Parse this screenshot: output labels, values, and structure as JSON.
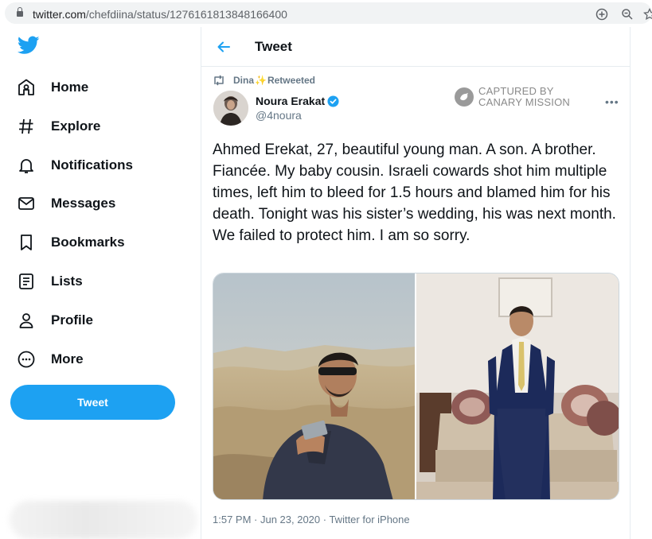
{
  "browser": {
    "url_host": "twitter.com",
    "url_path": "/chefdiina/status/1276161813848166400"
  },
  "sidebar": {
    "items": [
      {
        "label": "Home",
        "icon": "home-icon"
      },
      {
        "label": "Explore",
        "icon": "hashtag-icon"
      },
      {
        "label": "Notifications",
        "icon": "bell-icon"
      },
      {
        "label": "Messages",
        "icon": "envelope-icon"
      },
      {
        "label": "Bookmarks",
        "icon": "bookmark-icon"
      },
      {
        "label": "Lists",
        "icon": "list-icon"
      },
      {
        "label": "Profile",
        "icon": "person-icon"
      },
      {
        "label": "More",
        "icon": "more-circle-icon"
      }
    ],
    "tweet_button": "Tweet"
  },
  "header": {
    "title": "Tweet"
  },
  "tweet": {
    "retweeter": "Dina",
    "retweet_emoji": "✨",
    "retweet_label": "Retweeted",
    "author_name": "Noura Erakat",
    "author_handle": "@4noura",
    "watermark_line1": "CAPTURED BY",
    "watermark_line2": "CANARY MISSION",
    "text": "Ahmed Erekat, 27, beautiful young man. A son. A brother. Fiancée. My baby cousin. Israeli cowards shot him multiple times, left him to bleed for 1.5 hours and blamed him for his death. Tonight was his sister’s wedding, his was next month. We failed to protect him. I am so sorry.",
    "timestamp": "1:57 PM · Jun 23, 2020 · Twitter for iPhone"
  },
  "colors": {
    "brand": "#1da1f2",
    "text": "#0f1419",
    "muted": "#657786",
    "border": "#e6ecf0"
  }
}
